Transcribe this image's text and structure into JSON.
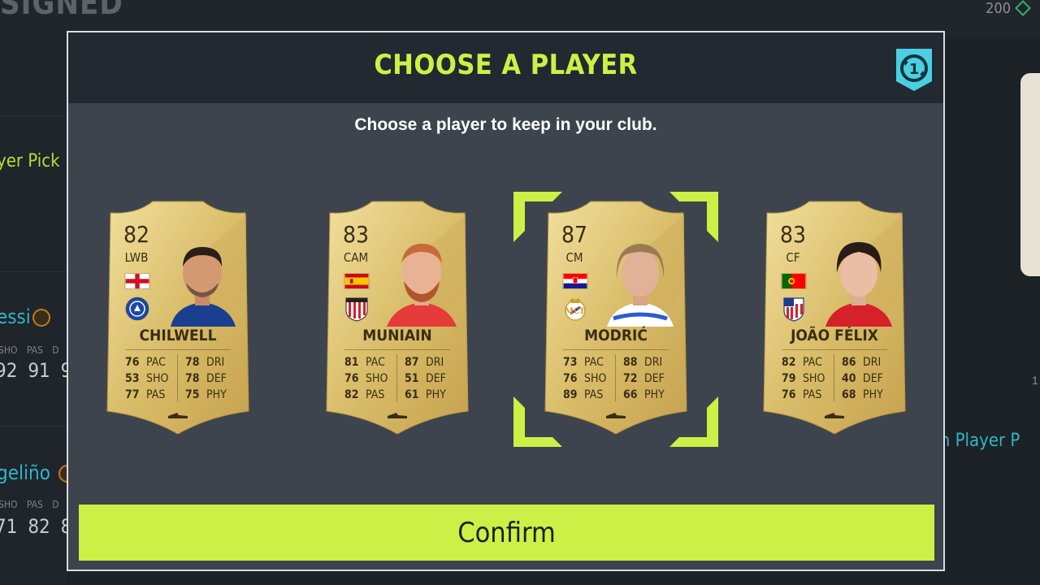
{
  "background": {
    "title_fragment": "SIGNED",
    "coins": "200",
    "left_rows": [
      {
        "name": "yer Pick"
      },
      {
        "name": "essi",
        "stat_labels": "SHO PAS D",
        "stat_values": "92 91 9"
      },
      {
        "name": "geliño",
        "stat_labels": "SHO PAS D",
        "stat_values": "71 82 8"
      }
    ],
    "right_text": "m Player P",
    "right_num": "1"
  },
  "modal": {
    "title": "CHOOSE A PLAYER",
    "pick_count": "1",
    "subtitle": "Choose a player to keep in your club.",
    "confirm_label": "Confirm"
  },
  "cards": [
    {
      "rating": "82",
      "position": "LWB",
      "name": "CHILWELL",
      "nation_flag": "england-flag",
      "club_badge": "chelsea-badge",
      "selected": false,
      "stats_left": [
        {
          "v": "76",
          "k": "PAC"
        },
        {
          "v": "53",
          "k": "SHO"
        },
        {
          "v": "77",
          "k": "PAS"
        }
      ],
      "stats_right": [
        {
          "v": "78",
          "k": "DRI"
        },
        {
          "v": "78",
          "k": "DEF"
        },
        {
          "v": "75",
          "k": "PHY"
        }
      ]
    },
    {
      "rating": "83",
      "position": "CAM",
      "name": "MUNIAIN",
      "nation_flag": "spain-flag",
      "club_badge": "athletic-club-badge",
      "selected": false,
      "stats_left": [
        {
          "v": "81",
          "k": "PAC"
        },
        {
          "v": "76",
          "k": "SHO"
        },
        {
          "v": "82",
          "k": "PAS"
        }
      ],
      "stats_right": [
        {
          "v": "87",
          "k": "DRI"
        },
        {
          "v": "51",
          "k": "DEF"
        },
        {
          "v": "61",
          "k": "PHY"
        }
      ]
    },
    {
      "rating": "87",
      "position": "CM",
      "name": "MODRIĆ",
      "nation_flag": "croatia-flag",
      "club_badge": "real-madrid-badge",
      "selected": true,
      "stats_left": [
        {
          "v": "73",
          "k": "PAC"
        },
        {
          "v": "76",
          "k": "SHO"
        },
        {
          "v": "89",
          "k": "PAS"
        }
      ],
      "stats_right": [
        {
          "v": "88",
          "k": "DRI"
        },
        {
          "v": "72",
          "k": "DEF"
        },
        {
          "v": "66",
          "k": "PHY"
        }
      ]
    },
    {
      "rating": "83",
      "position": "CF",
      "name": "JOÃO FÉLIX",
      "nation_flag": "portugal-flag",
      "club_badge": "atletico-madrid-badge",
      "selected": false,
      "stats_left": [
        {
          "v": "82",
          "k": "PAC"
        },
        {
          "v": "79",
          "k": "SHO"
        },
        {
          "v": "76",
          "k": "PAS"
        }
      ],
      "stats_right": [
        {
          "v": "86",
          "k": "DRI"
        },
        {
          "v": "40",
          "k": "DEF"
        },
        {
          "v": "68",
          "k": "PHY"
        }
      ]
    }
  ],
  "colors": {
    "accent": "#cdf046",
    "teal": "#2fb6c8",
    "card_gold": "#e2c877"
  }
}
